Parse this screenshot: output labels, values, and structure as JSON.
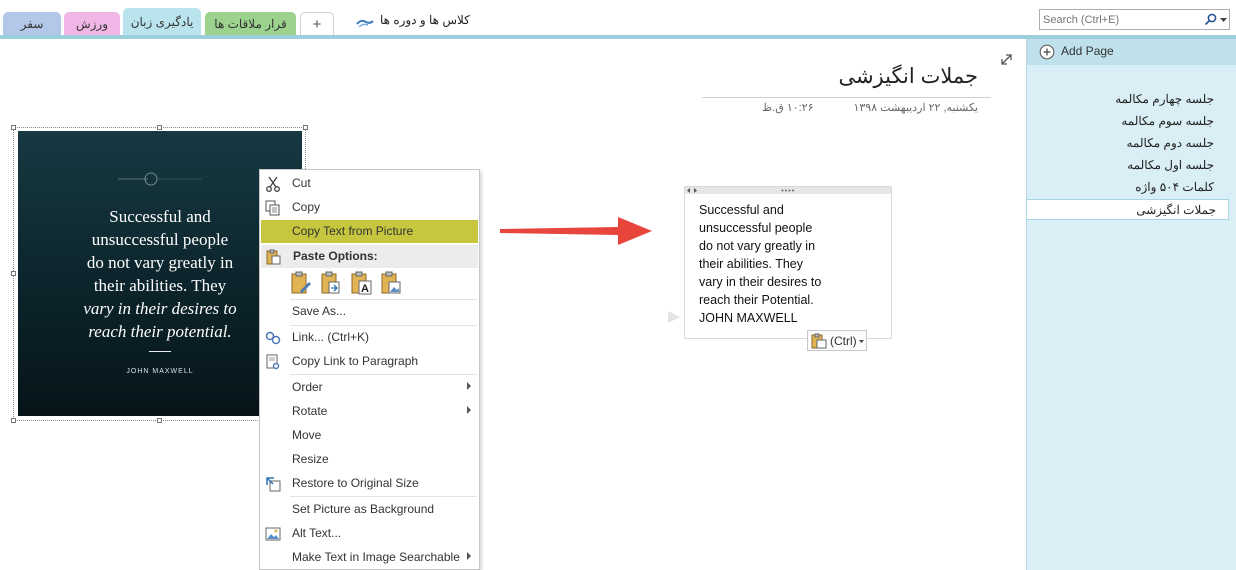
{
  "tabs": [
    {
      "label": "سفر",
      "color": "#b3c7e8"
    },
    {
      "label": "ورزش",
      "color": "#f0b6e6"
    },
    {
      "label": "یادگیری زبان",
      "color": "#b9e4ed"
    },
    {
      "label": "قرار ملاقات ها",
      "color": "#9bd38e"
    },
    {
      "label": "+",
      "color": "#ffffff"
    }
  ],
  "notebook": {
    "name": "کلاس ها و دوره ها"
  },
  "search": {
    "placeholder": "Search (Ctrl+E)"
  },
  "page_panel": {
    "add_page_label": "Add Page",
    "pages": [
      "جلسه چهارم مکالمه",
      "جلسه سوم مکالمه",
      "جلسه دوم مکالمه",
      "جلسه اول مکالمه",
      "کلمات ۵۰۴ واژه",
      "جملات انگیزشی"
    ],
    "selected_index": 5
  },
  "page": {
    "title": "جملات انگیزشی",
    "date": "یکشنبه, ۲۲ اردیبهشت ۱۳۹۸",
    "time": "۱۰:۲۶ ق.ظ"
  },
  "image": {
    "quote_lines": [
      "Successful and",
      "unsuccessful people",
      "do not vary greatly in",
      "their abilities. They",
      "vary in their desires to",
      "reach their potential."
    ],
    "author": "JOHN MAXWELL"
  },
  "context_menu": {
    "items": [
      {
        "label": "Cut",
        "icon": "scissors-icon"
      },
      {
        "label": "Copy",
        "icon": "copy-icon"
      },
      {
        "label": "Copy Text from Picture",
        "icon": "",
        "highlighted": true
      },
      {
        "label": "Paste Options:",
        "icon": "clipboard-icon",
        "header": true
      },
      {
        "label": "Save As...",
        "icon": ""
      },
      {
        "label": "Link...  (Ctrl+K)",
        "icon": "link-icon"
      },
      {
        "label": "Copy Link to Paragraph",
        "icon": "paragraph-link-icon"
      },
      {
        "label": "Order",
        "icon": "",
        "submenu": true
      },
      {
        "label": "Rotate",
        "icon": "",
        "submenu": true
      },
      {
        "label": "Move",
        "icon": ""
      },
      {
        "label": "Resize",
        "icon": ""
      },
      {
        "label": "Restore to Original Size",
        "icon": "restore-size-icon"
      },
      {
        "label": "Set Picture as Background",
        "icon": ""
      },
      {
        "label": "Alt Text...",
        "icon": "alt-text-icon"
      },
      {
        "label": "Make Text in Image Searchable",
        "icon": "",
        "submenu": true
      }
    ],
    "highlight_color": "#c6c63f"
  },
  "outline": {
    "lines": [
      "Successful and",
      "unsuccessful people",
      "do not vary greatly in",
      "their abilities. They",
      "vary in their desires to",
      "reach their Potential.",
      "JOHN MAXWELL"
    ]
  },
  "paste_chip": {
    "label": "(Ctrl)"
  }
}
